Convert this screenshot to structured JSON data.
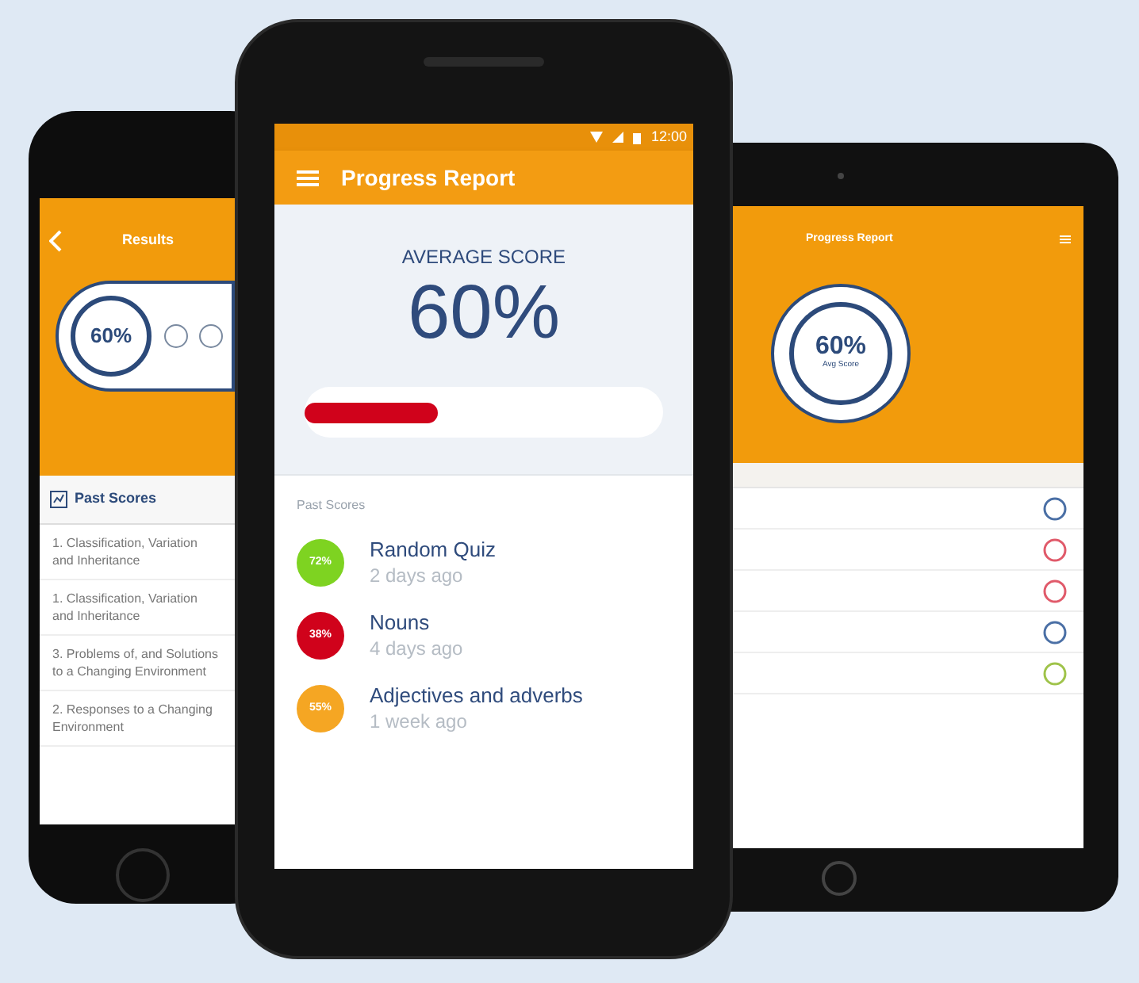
{
  "left_phone": {
    "title": "Results",
    "score": "60%",
    "section_title": "Past Scores",
    "items": [
      {
        "title": "1. Classification, Variation and Inheritance"
      },
      {
        "title": "1. Classification, Variation and Inheritance"
      },
      {
        "title": "3. Problems of, and Solutions to a Changing Environment"
      },
      {
        "title": "2. Responses to a Changing Environment"
      }
    ]
  },
  "center_phone": {
    "status_time": "12:00",
    "title": "Progress Report",
    "average_label": "AVERAGE SCORE",
    "average_value": "60%",
    "progress": {
      "level": 0.37
    },
    "section_title": "Past Scores",
    "scores": [
      {
        "badge": "72%",
        "color": "#7ed321",
        "title": "Random Quiz",
        "time": "2 days ago"
      },
      {
        "badge": "38%",
        "color": "#d0021b",
        "title": "Nouns",
        "time": "4 days ago"
      },
      {
        "badge": "55%",
        "color": "#f5a623",
        "title": "Adjectives and adverbs",
        "time": "1 week ago"
      }
    ]
  },
  "tablet": {
    "title": "Progress Report",
    "score": "60%",
    "score_label": "Avg Score",
    "rows": [
      {
        "color": "#4a6fa5"
      },
      {
        "color": "#e05a6a"
      },
      {
        "color": "#e05a6a"
      },
      {
        "color": "#4a6fa5"
      },
      {
        "color": "#9fc34a"
      }
    ]
  }
}
